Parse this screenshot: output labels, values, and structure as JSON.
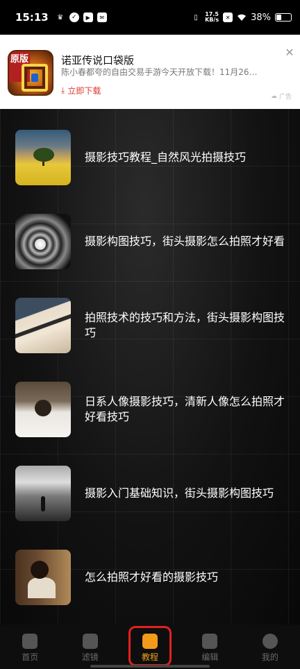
{
  "status_bar": {
    "time": "15:13",
    "net_speed_value": "17.5",
    "net_speed_unit": "KB/s",
    "battery": "38%"
  },
  "ad": {
    "badge": "原版",
    "title": "诺亚传说口袋版",
    "description": "陈小春都夸的自由交易手游今天开放下载！11月26…",
    "download_label": "立即下载",
    "ad_mark": "广告"
  },
  "articles": [
    {
      "title": "摄影技巧教程_自然风光拍摄技巧"
    },
    {
      "title": "摄影构图技巧，街头摄影怎么拍照才好看"
    },
    {
      "title": "拍照技术的技巧和方法，街头摄影构图技巧"
    },
    {
      "title": "日系人像摄影技巧，清新人像怎么拍照才好看技巧"
    },
    {
      "title": "摄影入门基础知识，街头摄影构图技巧"
    },
    {
      "title": "怎么拍照才好看的摄影技巧"
    }
  ],
  "bottom_nav": {
    "items": [
      {
        "label": "首页",
        "icon": "home-icon"
      },
      {
        "label": "滤镜",
        "icon": "magic-wand-icon"
      },
      {
        "label": "教程",
        "icon": "book-icon"
      },
      {
        "label": "编辑",
        "icon": "crop-icon"
      },
      {
        "label": "我的",
        "icon": "profile-icon"
      }
    ],
    "active_index": 2,
    "active_color": "#f29a1a"
  }
}
